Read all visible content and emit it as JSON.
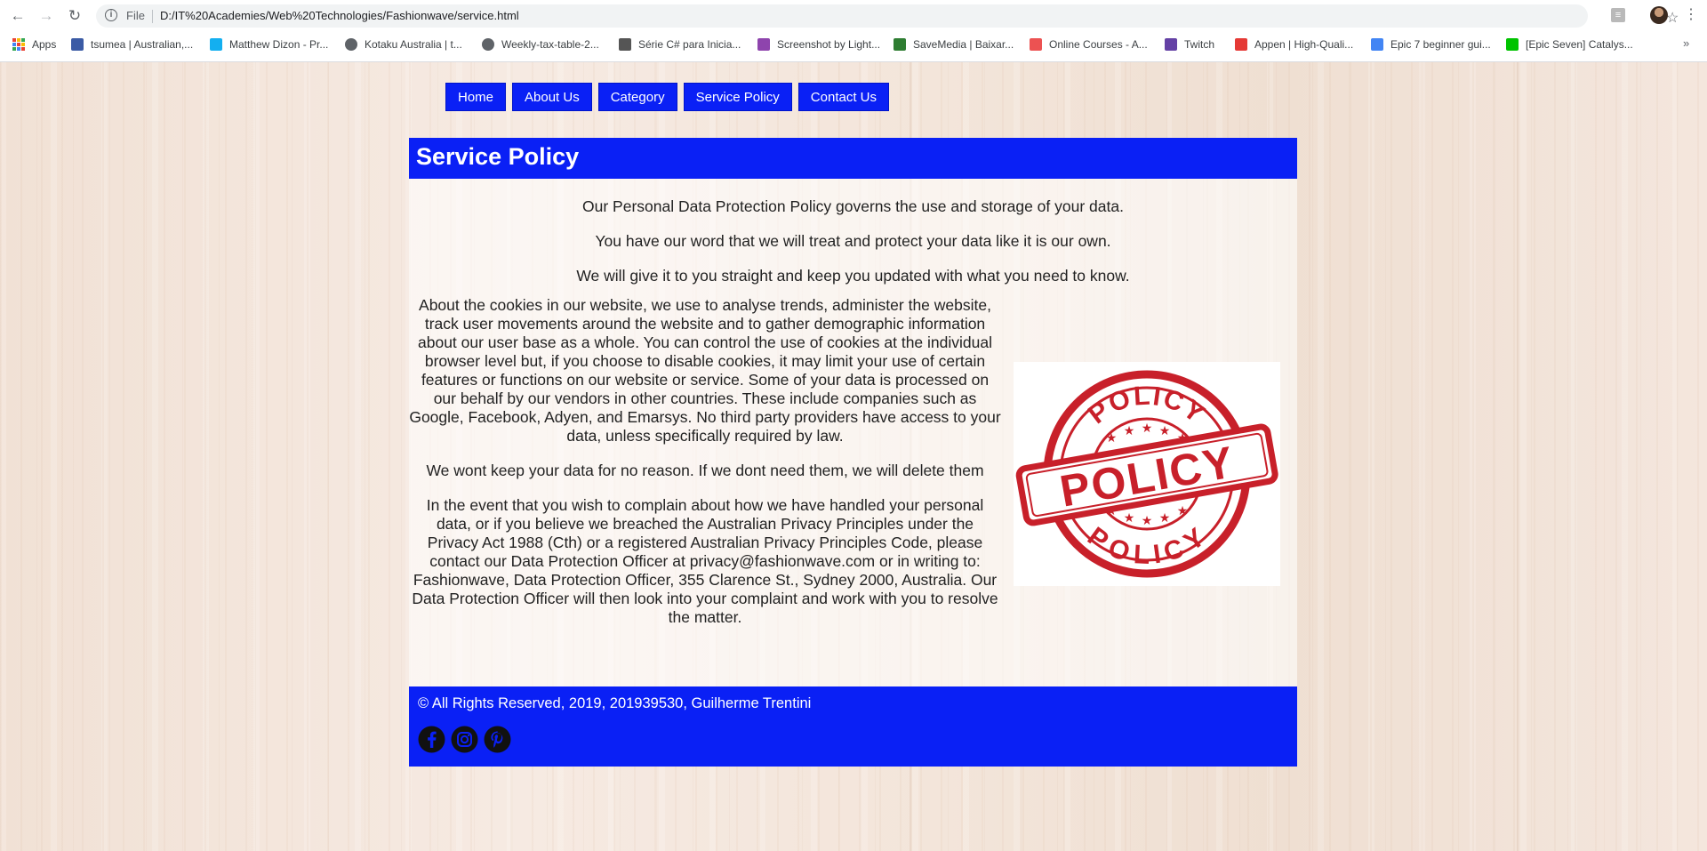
{
  "browser": {
    "omnibox_scheme": "File",
    "url": "D:/IT%20Academies/Web%20Technologies/Fashionwave/service.html",
    "bookmarks": [
      {
        "label": "Apps",
        "icon": "apps-grid-icon",
        "color": "#4285f4"
      },
      {
        "label": "tsumea | Australian,...",
        "icon": "shield-favicon",
        "color": "#3b5ba5"
      },
      {
        "label": "Matthew Dizon - Pr...",
        "icon": "artstation-favicon",
        "color": "#13aff0"
      },
      {
        "label": "Kotaku Australia | t...",
        "icon": "globe-favicon",
        "color": "#5f6368"
      },
      {
        "label": "Weekly-tax-table-2...",
        "icon": "globe-favicon",
        "color": "#5f6368"
      },
      {
        "label": "Série C# para Inicia...",
        "icon": "course-favicon",
        "color": "#555555"
      },
      {
        "label": "Screenshot by Light...",
        "icon": "lightshot-favicon",
        "color": "#8e44ad"
      },
      {
        "label": "SaveMedia | Baixar...",
        "icon": "play-favicon",
        "color": "#2e7d32"
      },
      {
        "label": "Online Courses - A...",
        "icon": "udemy-favicon",
        "color": "#ec5252"
      },
      {
        "label": "Twitch",
        "icon": "twitch-favicon",
        "color": "#6441a5"
      },
      {
        "label": "Appen | High-Quali...",
        "icon": "appen-favicon",
        "color": "#e53935"
      },
      {
        "label": "Epic 7 beginner gui...",
        "icon": "docs-favicon",
        "color": "#4285f4"
      },
      {
        "label": "[Epic Seven] Catalys...",
        "icon": "line-favicon",
        "color": "#00c300"
      }
    ],
    "bookmarks_more": "»"
  },
  "nav": {
    "items": [
      {
        "label": "Home"
      },
      {
        "label": "About Us"
      },
      {
        "label": "Category"
      },
      {
        "label": "Service Policy"
      },
      {
        "label": "Contact Us"
      }
    ],
    "color": "#0a20f5"
  },
  "page": {
    "title": "Service Policy",
    "intro": [
      "Our Personal Data Protection Policy governs the use and storage of your data.",
      "You have our word that we will treat and protect your data like it is our own.",
      "We will give it to you straight and keep you updated with what you need to know."
    ],
    "body": [
      "About the cookies in our website, we use to analyse trends, administer the website, track user movements around the website and to gather demographic information about our user base as a whole. You can control the use of cookies at the individual browser level but, if you choose to disable cookies, it may limit your use of certain features or functions on our website or service. Some of your data is processed on our behalf by our vendors in other countries. These include companies such as Google, Facebook, Adyen, and Emarsys. No third party providers have access to your data, unless specifically required by law.",
      "We wont keep your data for no reason. If we dont need them, we will delete them",
      "In the event that you wish to complain about how we have handled your personal data, or if you believe we breached the Australian Privacy Principles under the Privacy Act 1988 (Cth) or a registered Australian Privacy Principles Code, please contact our Data Protection Officer at privacy@fashionwave.com or in writing to: Fashionwave, Data Protection Officer, 355 Clarence St., Sydney 2000, Australia. Our Data Protection Officer will then look into your complaint and work with you to resolve the matter."
    ],
    "stamp": {
      "word": "POLICY",
      "color": "#c8202a"
    }
  },
  "footer": {
    "copyright": "© All Rights Reserved, 2019, 201939530, Guilherme Trentini",
    "social": [
      "facebook-icon",
      "instagram-icon",
      "pinterest-icon"
    ]
  }
}
